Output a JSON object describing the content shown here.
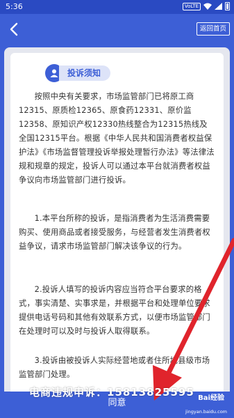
{
  "status_bar": {
    "time": "5:36",
    "network_badge": "VoLTE"
  },
  "header": {
    "back_icon": "chevron-left",
    "home_label": "返回首页"
  },
  "notice": {
    "title": "投诉须知",
    "title_icon": "user-icon",
    "paragraphs": [
      "按照中央有关要求，市场监管部门已将原工商12315、原质检12365、原食药12331、原价监12358、原知识产权12330热线整合为12315热线及全国12315平台。根据《中华人民共和国消费者权益保护法》《市场监督管理投诉举报处理暂行办法》等法律法规和规章的规定，投诉人可以通过本平台就消费者权益争议向市场监管部门进行投诉。",
      "1.本平台所称的投诉，是指消费者为生活消费需要购买、使用商品或者接受服务，与经营者发生消费者权益争议，请求市场监管部门解决该争议的行为。",
      "2.投诉人填写的投诉内容应当符合平台要求的格式，事实清楚、实事求是，并根据平台和处理单位要求提供电话号码和其他有效联系方式，以便市场监管部门在处理时可以及时与投诉人取得联系。",
      "3.投诉由被投诉人实际经营地或者住所地县级市场监管部门处理。"
    ]
  },
  "footer": {
    "agree_label": "同意"
  },
  "overlay": {
    "watermark_text": "电商违规申诉：15813825595",
    "brand_logo": "Bai经验",
    "brand_url": "jingyan.baidu.com",
    "arrow_color": "#e0242c"
  },
  "colors": {
    "primary": "#3d5fd6",
    "title_pill_bg": "#dde3f8",
    "page_bg": "#e5e7ef"
  }
}
